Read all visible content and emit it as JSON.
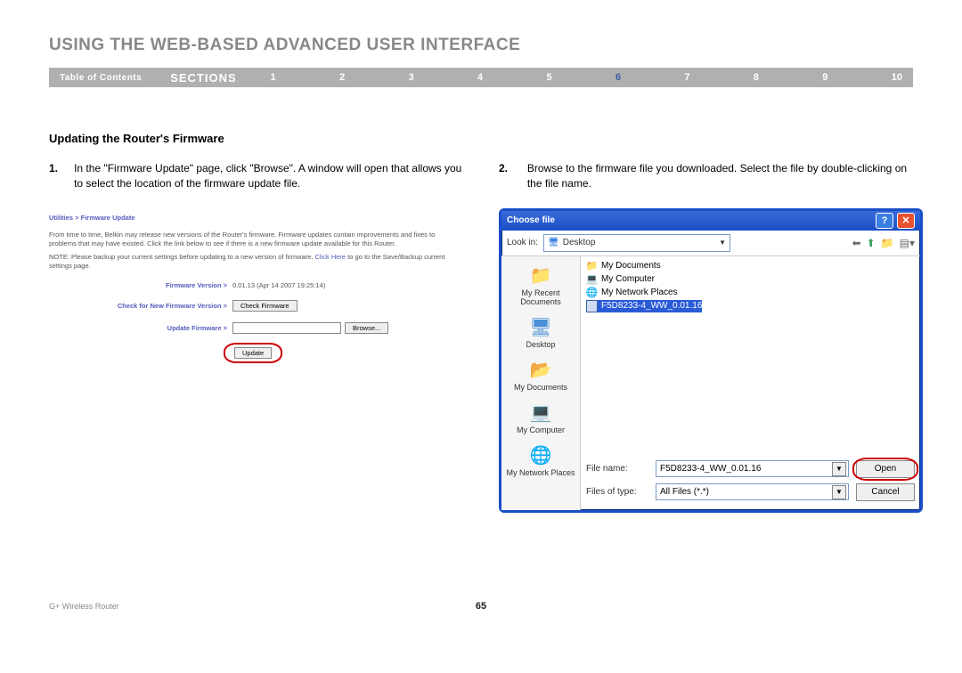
{
  "header": {
    "title": "USING THE WEB-BASED ADVANCED USER INTERFACE",
    "toc": "Table of Contents",
    "sections_label": "SECTIONS",
    "nums": [
      "1",
      "2",
      "3",
      "4",
      "5",
      "6",
      "7",
      "8",
      "9",
      "10"
    ],
    "active": "6"
  },
  "body": {
    "subheading": "Updating the Router's Firmware",
    "steps": {
      "s1_num": "1.",
      "s1_text": "In the \"Firmware Update\" page, click \"Browse\". A window will open that allows you to select the location of the firmware update file.",
      "s2_num": "2.",
      "s2_text": "Browse to the firmware file you downloaded. Select the file by double-clicking on the file name."
    }
  },
  "fw": {
    "breadcrumb": "Utilities > Firmware Update",
    "para1": "From time to time, Belkin may release new versions of the Router's firmware. Firmware updates contain improvements and fixes to problems that may have existed. Click the link below to see if there is a new firmware update available for this Router.",
    "para2_a": "NOTE: Please backup your current settings before updating to a new version of firmware.",
    "para2_link": "Click Here",
    "para2_b": "to go to the Save/Backup current settings page.",
    "row1_label": "Firmware Version >",
    "row1_val": "0.01.13 (Apr 14 2007 19:25:14)",
    "row2_label": "Check for New Firmware Version >",
    "row2_btn": "Check Firmware",
    "row3_label": "Update Firmware >",
    "row3_btn": "Browse...",
    "update_btn": "Update"
  },
  "dlg": {
    "title": "Choose file",
    "look_in_label": "Look in:",
    "look_in_value": "Desktop",
    "places": {
      "recent": "My Recent Documents",
      "desktop": "Desktop",
      "mydocs": "My Documents",
      "mycomp": "My Computer",
      "network": "My Network Places"
    },
    "files": {
      "f1": "My Documents",
      "f2": "My Computer",
      "f3": "My Network Places",
      "f4": "F5D8233-4_WW_0.01.16"
    },
    "fname_label": "File name:",
    "fname_val": "F5D8233-4_WW_0.01.16",
    "ftype_label": "Files of type:",
    "ftype_val": "All Files (*.*)",
    "open": "Open",
    "cancel": "Cancel"
  },
  "footer": {
    "product": "G+ Wireless Router",
    "page": "65"
  }
}
